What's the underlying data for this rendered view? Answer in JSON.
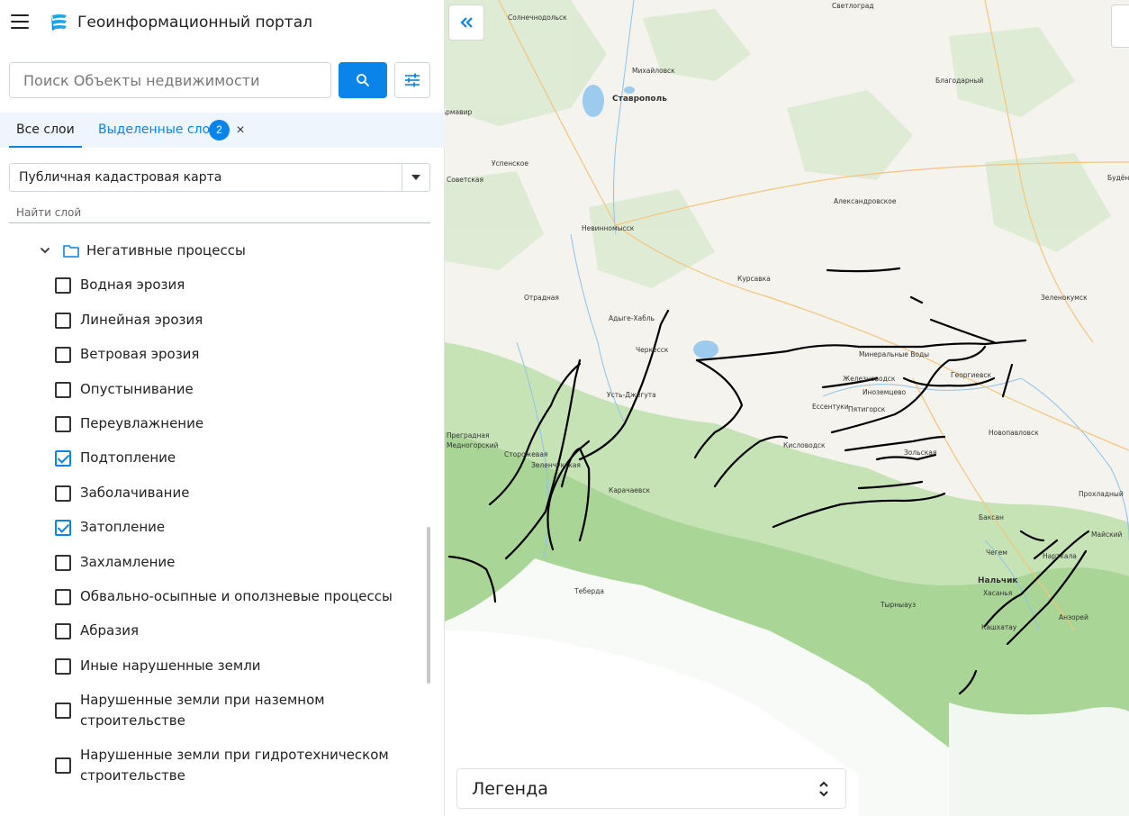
{
  "header": {
    "title": "Геоинформационный портал"
  },
  "search": {
    "placeholder": "Поиск Объекты недвижимости"
  },
  "tabs": {
    "all": "Все слои",
    "selected": "Выделенные слои",
    "selected_count": "2",
    "close": "×"
  },
  "basemap_select": {
    "value": "Публичная кадастровая карта"
  },
  "layer_search": {
    "placeholder": "Найти слой"
  },
  "group": {
    "label": "Негативные процессы"
  },
  "layers": [
    {
      "label": "Водная эрозия",
      "checked": false
    },
    {
      "label": "Линейная эрозия",
      "checked": false
    },
    {
      "label": "Ветровая эрозия",
      "checked": false
    },
    {
      "label": "Опустынивание",
      "checked": false
    },
    {
      "label": "Переувлажнение",
      "checked": false
    },
    {
      "label": "Подтопление",
      "checked": true
    },
    {
      "label": "Заболачивание",
      "checked": false
    },
    {
      "label": "Затопление",
      "checked": true
    },
    {
      "label": "Захламление",
      "checked": false
    },
    {
      "label": "Обвально-осыпные и оползневые процессы",
      "checked": false
    },
    {
      "label": "Абразия",
      "checked": false
    },
    {
      "label": "Иные нарушенные земли",
      "checked": false
    },
    {
      "label": "Нарушенные земли при наземном строительстве",
      "checked": false
    },
    {
      "label": "Нарушенные земли при гидротехническом строительстве",
      "checked": false
    }
  ],
  "legend": {
    "title": "Легенда"
  },
  "map": {
    "places": [
      {
        "name": "Светлоград"
      },
      {
        "name": "Солнечнодольск"
      },
      {
        "name": "Михайловск"
      },
      {
        "name": "Ставрополь",
        "major": true
      },
      {
        "name": "Благодарный"
      },
      {
        "name": "Армавир"
      },
      {
        "name": "Успенское"
      },
      {
        "name": "Советская"
      },
      {
        "name": "Александровское"
      },
      {
        "name": "Невинномысск"
      },
      {
        "name": "Курсавка"
      },
      {
        "name": "Отрадная"
      },
      {
        "name": "Зеленокумск"
      },
      {
        "name": "Будённовск"
      },
      {
        "name": "Адыге-Хабль"
      },
      {
        "name": "Черкесск"
      },
      {
        "name": "Минеральные Воды"
      },
      {
        "name": "Железноводск"
      },
      {
        "name": "Георгиевск"
      },
      {
        "name": "Иноземцево"
      },
      {
        "name": "Усть-Джегута"
      },
      {
        "name": "Ессентуки"
      },
      {
        "name": "Пятигорск"
      },
      {
        "name": "Преградная"
      },
      {
        "name": "Медногорский"
      },
      {
        "name": "Сторожевая"
      },
      {
        "name": "Зеленчукская"
      },
      {
        "name": "Кисловодск"
      },
      {
        "name": "Новопавловск"
      },
      {
        "name": "Зольская"
      },
      {
        "name": "Карачаевск"
      },
      {
        "name": "Прохладный"
      },
      {
        "name": "Баксан"
      },
      {
        "name": "Майский"
      },
      {
        "name": "Чегем"
      },
      {
        "name": "Нарткала"
      },
      {
        "name": "Нальчик",
        "major": true
      },
      {
        "name": "Хасанья"
      },
      {
        "name": "Теберда"
      },
      {
        "name": "Тырныауз"
      },
      {
        "name": "Кашхатау"
      },
      {
        "name": "Анзорей"
      }
    ]
  }
}
